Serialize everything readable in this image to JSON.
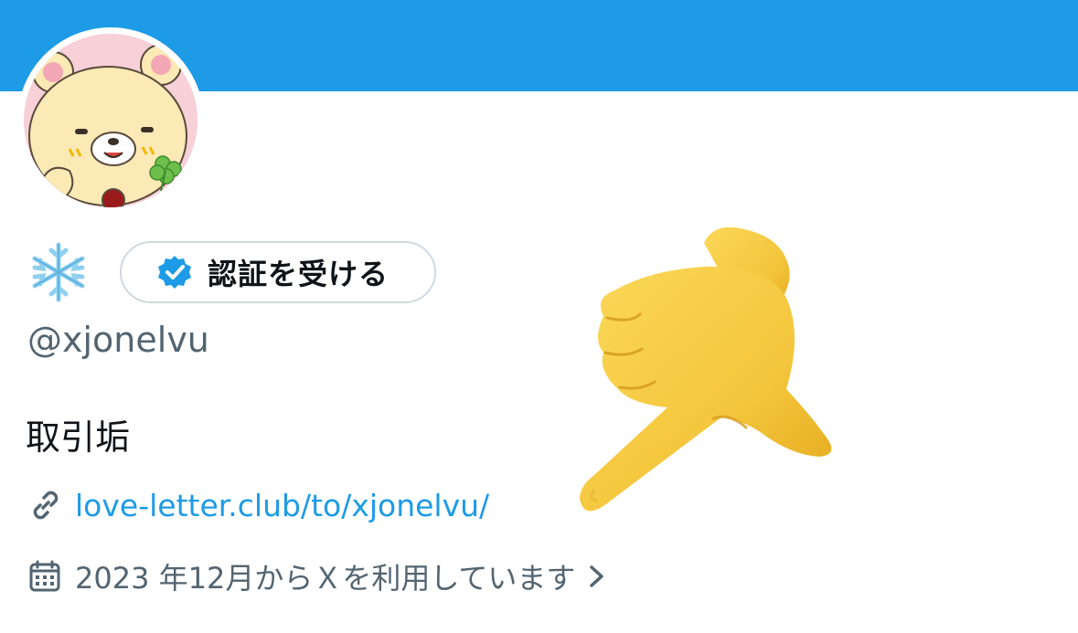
{
  "banner": {
    "color": "#1d9be6"
  },
  "avatar": {
    "description_icon": "bear-with-clover-avatar"
  },
  "display_name": {
    "icon": "snowflake-icon"
  },
  "verify_button": {
    "label": "認証を受ける",
    "icon": "verified-badge-icon",
    "accent": "#1d9be6"
  },
  "profile": {
    "handle": "@xjonelvu",
    "bio": "取引垢",
    "link": "love-letter.club/to/xjonelvu/",
    "joined": "2023 年12月からＸを利用しています"
  },
  "overlay": {
    "icon": "pointing-hand-icon"
  },
  "colors": {
    "link": "#1d9be6",
    "muted": "#536471",
    "text": "#0f1419"
  }
}
